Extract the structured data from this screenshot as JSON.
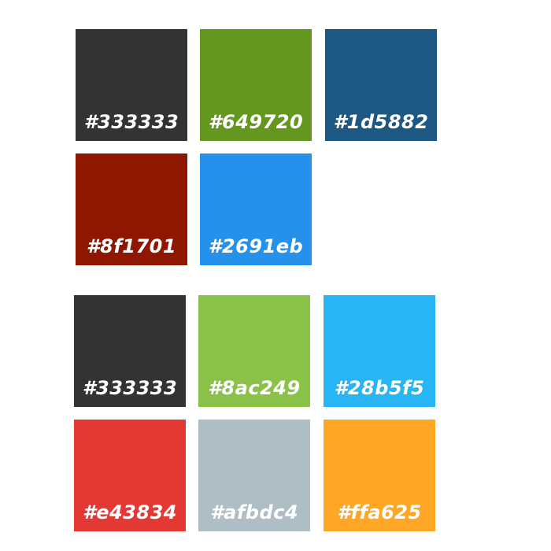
{
  "palettes": [
    {
      "swatches": [
        {
          "hex": "#333333",
          "color": "#333333"
        },
        {
          "hex": "#649720",
          "color": "#649720"
        },
        {
          "hex": "#1d5882",
          "color": "#1d5882"
        },
        {
          "hex": "#8f1701",
          "color": "#8f1701"
        },
        {
          "hex": "#2691eb",
          "color": "#2691eb"
        }
      ]
    },
    {
      "swatches": [
        {
          "hex": "#333333",
          "color": "#333333"
        },
        {
          "hex": "#8ac249",
          "color": "#8ac249"
        },
        {
          "hex": "#28b5f5",
          "color": "#28b5f5"
        },
        {
          "hex": "#e43834",
          "color": "#e43834"
        },
        {
          "hex": "#afbdc4",
          "color": "#afbdc4"
        },
        {
          "hex": "#ffa625",
          "color": "#ffa625"
        }
      ]
    }
  ]
}
